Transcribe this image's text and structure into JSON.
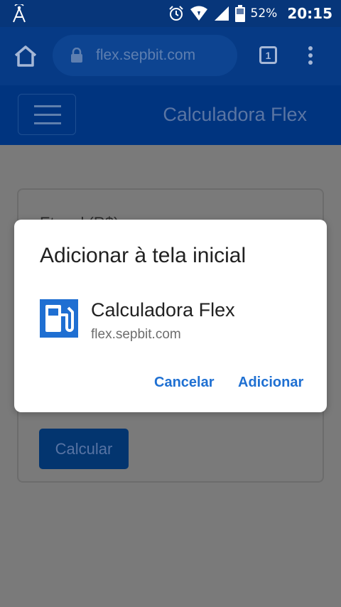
{
  "status_bar": {
    "battery_percent": "52%",
    "time": "20:15",
    "icons": [
      "cell-tower-icon",
      "alarm-icon",
      "wifi-icon",
      "signal-icon",
      "battery-icon"
    ]
  },
  "browser": {
    "url": "flex.sepbit.com",
    "tab_count": "1",
    "icons": [
      "home-icon",
      "lock-icon",
      "menu-dots-icon"
    ]
  },
  "app_bar": {
    "title": "Calculadora Flex",
    "icons": [
      "hamburger-menu-icon"
    ]
  },
  "page": {
    "field_label": "Etanol (R$)",
    "calculate_button": "Calcular"
  },
  "dialog": {
    "title": "Adicionar à tela inicial",
    "app_name": "Calculadora Flex",
    "app_url": "flex.sepbit.com",
    "cancel_label": "Cancelar",
    "add_label": "Adicionar",
    "icon": "fuel-pump-icon"
  },
  "colors": {
    "primary": "#00347f",
    "dialog_button": "#1f70d2"
  }
}
